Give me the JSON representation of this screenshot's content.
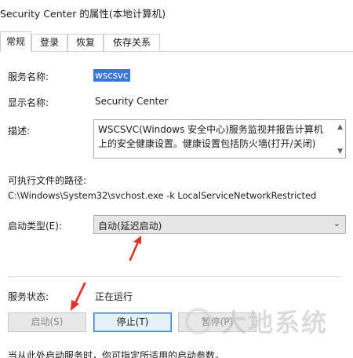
{
  "window": {
    "title": "Security Center 的属性(本地计算机)"
  },
  "tabs": [
    {
      "label": "常规"
    },
    {
      "label": "登录"
    },
    {
      "label": "恢复"
    },
    {
      "label": "依存关系"
    }
  ],
  "general": {
    "service_name_label": "服务名称:",
    "service_name_value": "wscsvc",
    "display_name_label": "显示名称:",
    "display_name_value": "Security Center",
    "description_label": "描述:",
    "description_value": "WSCSVC(Windows 安全中心)服务监视并报告计算机上的安全健康设置。健康设置包括防火墙(打开/关闭)",
    "exec_path_label": "可执行文件的路径:",
    "exec_path_value": "C:\\Windows\\System32\\svchost.exe -k LocalServiceNetworkRestricted",
    "startup_type_label": "启动类型(E):",
    "startup_type_value": "自动(延迟启动)",
    "service_status_label": "服务状态:",
    "service_status_value": "正在运行"
  },
  "buttons": {
    "start": "启动(S)",
    "stop": "停止(T)",
    "pause": "暂停(P)"
  },
  "footer_text": "当从此处启动服务时，你可指定所适用的启动参数。",
  "watermark": "大地系统",
  "colors": {
    "selection": "#3a78d8",
    "annotation_arrow": "#e0332a",
    "primary_button_border": "#3c7fd6"
  }
}
